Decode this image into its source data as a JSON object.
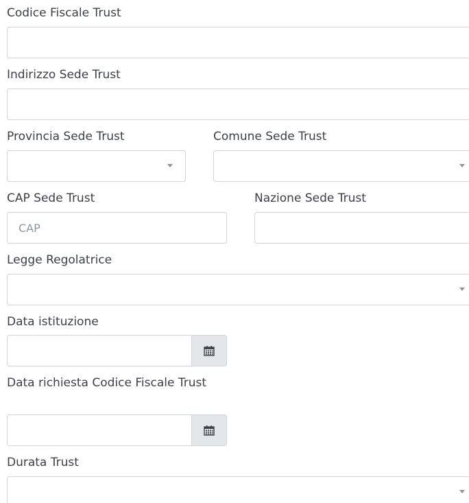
{
  "fields": {
    "codice_fiscale": {
      "label": "Codice Fiscale Trust",
      "value": ""
    },
    "indirizzo": {
      "label": "Indirizzo Sede Trust",
      "value": ""
    },
    "provincia": {
      "label": "Provincia Sede Trust",
      "selected": ""
    },
    "comune": {
      "label": "Comune Sede Trust",
      "selected": ""
    },
    "cap": {
      "label": "CAP Sede Trust",
      "placeholder": "CAP",
      "value": ""
    },
    "nazione": {
      "label": "Nazione Sede Trust",
      "value": ""
    },
    "legge": {
      "label": "Legge Regolatrice",
      "selected": ""
    },
    "data_istituzione": {
      "label": "Data istituzione",
      "value": ""
    },
    "data_richiesta": {
      "label": "Data richiesta Codice Fiscale Trust",
      "value": ""
    },
    "durata": {
      "label": "Durata Trust",
      "selected": ""
    }
  },
  "icons": {
    "calendar": "calendar-icon",
    "dropdown": "chevron-down-icon"
  },
  "colors": {
    "border": "#cfd4da",
    "addon_bg": "#e4e7ea",
    "label_text": "#3b3f45",
    "placeholder": "#8e969d"
  }
}
